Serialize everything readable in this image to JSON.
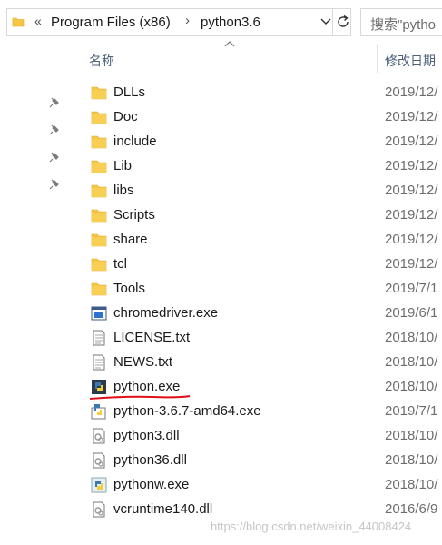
{
  "address_bar": {
    "overflow_chevron": "«",
    "crumbs": [
      "Program Files (x86)",
      "python3.6"
    ],
    "separator": "›"
  },
  "search": {
    "placeholder": "搜索\"pytho"
  },
  "columns": {
    "name": "名称",
    "date_modified": "修改日期"
  },
  "files": [
    {
      "name": "DLLs",
      "date": "2019/12/",
      "icon": "folder-icon"
    },
    {
      "name": "Doc",
      "date": "2019/12/",
      "icon": "folder-icon"
    },
    {
      "name": "include",
      "date": "2019/12/",
      "icon": "folder-icon"
    },
    {
      "name": "Lib",
      "date": "2019/12/",
      "icon": "folder-icon"
    },
    {
      "name": "libs",
      "date": "2019/12/",
      "icon": "folder-icon"
    },
    {
      "name": "Scripts",
      "date": "2019/12/",
      "icon": "folder-icon"
    },
    {
      "name": "share",
      "date": "2019/12/",
      "icon": "folder-icon"
    },
    {
      "name": "tcl",
      "date": "2019/12/",
      "icon": "folder-icon"
    },
    {
      "name": "Tools",
      "date": "2019/7/1",
      "icon": "folder-icon"
    },
    {
      "name": "chromedriver.exe",
      "date": "2019/6/1",
      "icon": "exe-window-icon"
    },
    {
      "name": "LICENSE.txt",
      "date": "2018/10/",
      "icon": "text-file-icon"
    },
    {
      "name": "NEWS.txt",
      "date": "2018/10/",
      "icon": "text-file-icon"
    },
    {
      "name": "python.exe",
      "date": "2018/10/",
      "icon": "python-exe-icon"
    },
    {
      "name": "python-3.6.7-amd64.exe",
      "date": "2019/7/1",
      "icon": "installer-icon"
    },
    {
      "name": "python3.dll",
      "date": "2018/10/",
      "icon": "dll-file-icon"
    },
    {
      "name": "python36.dll",
      "date": "2018/10/",
      "icon": "dll-file-icon"
    },
    {
      "name": "pythonw.exe",
      "date": "2018/10/",
      "icon": "pythonw-exe-icon"
    },
    {
      "name": "vcruntime140.dll",
      "date": "2016/6/9",
      "icon": "dll-file-icon"
    }
  ],
  "watermark": "https://blog.csdn.net/weixin_44008424",
  "colors": {
    "folder": "#f6c744",
    "header_text": "#4c607a",
    "annotation_underline": "#e0101a"
  }
}
